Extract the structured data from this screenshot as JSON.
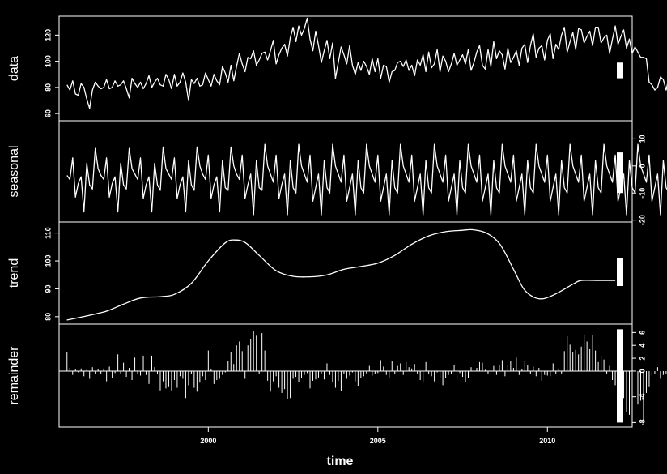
{
  "colors": {
    "background": "#000000",
    "foreground": "#ffffff"
  },
  "chart_data": {
    "type": "line",
    "title": "",
    "xlabel": "time",
    "xlim": [
      1995.6,
      2012.5
    ],
    "xticks": [
      2000,
      2005,
      2010
    ],
    "xtick_labels": [
      "2000",
      "2005",
      "2010"
    ],
    "panels": [
      {
        "name": "data",
        "label": "data",
        "kind": "line",
        "ylim": [
          57,
          132
        ],
        "yticks": [
          60,
          80,
          100,
          120
        ],
        "ytick_labels": [
          "60",
          "80",
          "100",
          "120"
        ],
        "tick_side": "left",
        "scale_bar": [
          87,
          99
        ],
        "x_start": 1995.8333,
        "x_step": 0.0833333,
        "values": [
          82,
          78,
          85,
          75,
          74,
          83,
          80,
          71,
          64,
          78,
          84,
          81,
          79,
          80,
          86,
          79,
          80,
          85,
          81,
          82,
          85,
          79,
          72,
          87,
          83,
          80,
          84,
          79,
          83,
          89,
          80,
          84,
          87,
          82,
          81,
          90,
          86,
          79,
          90,
          81,
          84,
          91,
          84,
          70,
          86,
          83,
          87,
          81,
          82,
          91,
          86,
          81,
          90,
          85,
          82,
          96,
          91,
          84,
          97,
          85,
          96,
          106,
          98,
          92,
          103,
          102,
          108,
          97,
          101,
          106,
          107,
          101,
          108,
          116,
          98,
          105,
          110,
          113,
          104,
          118,
          126,
          115,
          127,
          120,
          125,
          133,
          117,
          108,
          123,
          112,
          99,
          108,
          116,
          102,
          114,
          87,
          99,
          111,
          105,
          98,
          112,
          97,
          90,
          99,
          93,
          100,
          96,
          90,
          102,
          92,
          102,
          87,
          97,
          96,
          84,
          92,
          93,
          99,
          100,
          96,
          101,
          93,
          97,
          89,
          101,
          97,
          105,
          92,
          107,
          95,
          98,
          109,
          92,
          104,
          100,
          92,
          98,
          106,
          97,
          101,
          105,
          98,
          109,
          93,
          99,
          107,
          112,
          97,
          94,
          109,
          96,
          115,
          102,
          108,
          105,
          94,
          110,
          99,
          103,
          108,
          97,
          110,
          113,
          99,
          112,
          121,
          103,
          110,
          112,
          101,
          116,
          121,
          102,
          113,
          109,
          120,
          126,
          107,
          115,
          122,
          109,
          125,
          124,
          114,
          119,
          123,
          112,
          126,
          126,
          114,
          118,
          120,
          106,
          117,
          127,
          113,
          119,
          124,
          110,
          117,
          106,
          111,
          107,
          103,
          103,
          102,
          84,
          82,
          78,
          80,
          88,
          86,
          78,
          88,
          70,
          94,
          91,
          86,
          92,
          80,
          95,
          96,
          84,
          100,
          88,
          100,
          84,
          98,
          97,
          89,
          103,
          105,
          92,
          102,
          91,
          102,
          97,
          90,
          103,
          97,
          86,
          88,
          93,
          87,
          88
        ]
      },
      {
        "name": "seasonal",
        "label": "seasonal",
        "kind": "line",
        "ylim": [
          -19.5,
          15.5
        ],
        "yticks": [
          -20,
          -10,
          0,
          10
        ],
        "ytick_labels": [
          "-20",
          "-10",
          "0",
          "10"
        ],
        "tick_side": "right",
        "scale_bar": [
          -10,
          5
        ],
        "x_start": 1995.8333,
        "x_step": 0.0833333,
        "values": [
          -3.5,
          -5,
          3,
          -11.5,
          -6.5,
          -4,
          -17,
          1,
          -7,
          -8.5,
          6.5,
          -1,
          -3.5,
          -5,
          3,
          -11.5,
          -6.5,
          -4,
          -17,
          1,
          -7,
          -8.5,
          6.5,
          -1,
          -3,
          -5,
          3,
          -12,
          -7,
          -4,
          -17,
          1,
          -7,
          -9,
          7,
          -1,
          -3,
          -5,
          3,
          -12,
          -7,
          -4,
          -17,
          2,
          -7,
          -9,
          7,
          0,
          -3,
          -5,
          4,
          -12,
          -7,
          -4,
          -17,
          2,
          -8,
          -9,
          7,
          0,
          -3,
          -5,
          4,
          -12,
          -7,
          -3,
          -18,
          2,
          -8,
          -9,
          8,
          0,
          -3,
          -6,
          4,
          -12,
          -7,
          -3,
          -18,
          2,
          -8,
          -10,
          8,
          0,
          -3,
          -6,
          4,
          -13,
          -8,
          -3,
          -18,
          2,
          -8,
          -10,
          8,
          0,
          -3,
          -6,
          4,
          -13,
          -8,
          -3,
          -18,
          2,
          -8,
          -10,
          8,
          0,
          -3,
          -6,
          4,
          -13,
          -8,
          -3,
          -18,
          2,
          -8,
          -10,
          8,
          0,
          -3,
          -6,
          4,
          -13,
          -8,
          -3,
          -18,
          2,
          -8,
          -10,
          8,
          0,
          -3,
          -6,
          4,
          -13,
          -8,
          -3,
          -18,
          2,
          -8,
          -10,
          8,
          0,
          -3,
          -6,
          4,
          -13,
          -8,
          -3,
          -18,
          2,
          -8,
          -10,
          8,
          0,
          -3,
          -6,
          4,
          -13,
          -8,
          -3,
          -18,
          2,
          -8,
          -10,
          8,
          0,
          -3,
          -6,
          4,
          -13,
          -8,
          -3,
          -18,
          2,
          -8,
          -10,
          8,
          0,
          -3,
          -6,
          4,
          -13,
          -8,
          -3,
          -18,
          2,
          -8,
          -10,
          8,
          0,
          -3,
          -6,
          4,
          -13,
          -8,
          -3,
          -18,
          2,
          -8,
          -10,
          8,
          0,
          -3,
          -6,
          4,
          -13,
          -8,
          -3,
          -18,
          2,
          -8,
          -10,
          8,
          0,
          -3,
          -6,
          4,
          -13,
          -8,
          -3,
          -18,
          2,
          -8,
          -10,
          8,
          0,
          -3,
          -6,
          4,
          -13,
          -8,
          -3,
          -18,
          2,
          -8,
          -10,
          8,
          0,
          -3,
          -6,
          4,
          -13,
          -8,
          -3,
          -18,
          2,
          -8,
          -10,
          8,
          0,
          -3,
          -6,
          4,
          -13,
          -8,
          -3,
          -18,
          2,
          -8,
          -10,
          8,
          0,
          -3,
          -6,
          4,
          -13,
          -8,
          -3,
          -18,
          2,
          -8,
          -10,
          8,
          0,
          -3,
          -6,
          4,
          -13,
          -8,
          -3,
          -18,
          2,
          -8,
          -10,
          8,
          0,
          -2,
          -4,
          -3.5,
          1
        ]
      },
      {
        "name": "trend",
        "label": "trend",
        "kind": "line",
        "ylim": [
          78.5,
          112.8
        ],
        "yticks": [
          80,
          90,
          100,
          110
        ],
        "ytick_labels": [
          "80",
          "90",
          "100",
          "110"
        ],
        "tick_side": "left",
        "scale_bar": [
          91,
          101
        ],
        "points": [
          [
            1995.83,
            78.8
          ],
          [
            1996.5,
            80.5
          ],
          [
            1997.0,
            82
          ],
          [
            1997.5,
            84.5
          ],
          [
            1998.0,
            86.7
          ],
          [
            1998.6,
            87.2
          ],
          [
            1999.0,
            88
          ],
          [
            1999.5,
            92
          ],
          [
            2000.0,
            100
          ],
          [
            2000.5,
            106.5
          ],
          [
            2000.8,
            107.5
          ],
          [
            2001.1,
            106.5
          ],
          [
            2001.5,
            102
          ],
          [
            2002.0,
            96.5
          ],
          [
            2002.5,
            94.5
          ],
          [
            2003.0,
            94.3
          ],
          [
            2003.5,
            95
          ],
          [
            2004.0,
            97
          ],
          [
            2004.5,
            98
          ],
          [
            2005.0,
            99.2
          ],
          [
            2005.5,
            102
          ],
          [
            2006.0,
            106
          ],
          [
            2006.5,
            109
          ],
          [
            2007.0,
            110.5
          ],
          [
            2007.5,
            111
          ],
          [
            2007.8,
            111.2
          ],
          [
            2008.2,
            110
          ],
          [
            2008.6,
            106
          ],
          [
            2009.0,
            97
          ],
          [
            2009.3,
            90
          ],
          [
            2009.6,
            87
          ],
          [
            2009.9,
            86.5
          ],
          [
            2010.3,
            88.5
          ],
          [
            2010.8,
            92
          ],
          [
            2011.0,
            93
          ],
          [
            2011.5,
            93
          ],
          [
            2012.0,
            93
          ]
        ]
      },
      {
        "name": "remainder",
        "label": "remainder",
        "kind": "bar",
        "ylim": [
          -8.2,
          6.8
        ],
        "yticks": [
          -8,
          -4,
          0,
          2,
          4,
          6
        ],
        "ytick_labels": [
          "-8",
          "-4",
          "0",
          "2",
          "4",
          "6"
        ],
        "tick_side": "right",
        "scale_bar": [
          -8,
          6.5
        ],
        "x_start": 1995.8333,
        "x_step": 0.0833333,
        "values": [
          3,
          0.5,
          -0.6,
          0.3,
          -0.2,
          0.4,
          -0.8,
          0.2,
          -1.2,
          0.6,
          -0.4,
          0.3,
          -0.5,
          0.4,
          -1.6,
          0.7,
          -1.1,
          -0.3,
          2.6,
          -0.5,
          1.3,
          -0.9,
          0.5,
          -1.4,
          2.1,
          -0.4,
          -0.7,
          2.4,
          -0.6,
          -2,
          2.4,
          0.6,
          -0.5,
          -3,
          -1.6,
          -2.7,
          -2.5,
          -3,
          -1.4,
          -2.6,
          -0.8,
          -1.2,
          -4.2,
          -2.2,
          -0.4,
          -2.6,
          -3.2,
          -1.8,
          -0.8,
          -1.4,
          3.2,
          0.3,
          -2,
          -1.4,
          -1.2,
          -0.6,
          -0.2,
          1.6,
          2.9,
          1.1,
          4,
          4.6,
          3.1,
          -1.2,
          4,
          5,
          6.2,
          5.5,
          -0.4,
          5.9,
          3.2,
          -1.5,
          -3.2,
          -1.6,
          -0.8,
          -2.6,
          -3.4,
          -2.8,
          -4.3,
          -4.2,
          -1.2,
          -0.9,
          -1.7,
          -1.1,
          -0.6,
          -0.3,
          -2.7,
          -1.5,
          -1.3,
          -1,
          -0.5,
          -1.3,
          1.2,
          -0.6,
          -1.7,
          -2.6,
          -1.5,
          -3.1,
          -0.4,
          -1.2,
          -0.7,
          -0.2,
          -1.6,
          -2.3,
          -1.1,
          -0.8,
          -0.4,
          0.8,
          -0.7,
          -0.5,
          -0.3,
          1.7,
          0.7,
          -0.6,
          -1,
          1.5,
          -0.4,
          0.8,
          1.2,
          -0.6,
          1.4,
          0.6,
          0.4,
          1.1,
          -0.5,
          -1.4,
          -1.8,
          1.4,
          -0.4,
          -0.8,
          -1.6,
          -0.2,
          -1.2,
          -2.2,
          -1.1,
          -0.6,
          -0.4,
          0.9,
          -1.4,
          -0.3,
          -0.9,
          -1.7,
          -1.1,
          0.6,
          -1.2,
          0.5,
          1.4,
          1.3,
          0.2,
          -0.5,
          -0.2,
          0.8,
          -0.6,
          0.9,
          1.7,
          -0.8,
          1,
          1.6,
          0.5,
          2.1,
          -0.6,
          0.3,
          1.6,
          1,
          -0.4,
          0.7,
          -0.8,
          0.5,
          -1.5,
          -0.6,
          -0.7,
          -0.8,
          1.2,
          -0.5,
          0.4,
          -0.4,
          3.1,
          5.4,
          4.1,
          2.9,
          3.3,
          2.6,
          3.8,
          5.7,
          4.6,
          3.4,
          5.6,
          3.2,
          1.4,
          2.4,
          1.8,
          -0.5,
          0.8,
          -1.4,
          -2.2,
          -3.5,
          -5.6,
          -4.2,
          -6.3,
          -6.8,
          -5.8,
          -7.5,
          -5.2,
          -4.6,
          -8.1,
          -3.4,
          -2.5,
          -0.8,
          -0.4,
          0.6,
          -1.2,
          -0.6,
          -0.5,
          0.2,
          0.7,
          -1.3,
          1.2,
          -0.2,
          2.7,
          0.6,
          -0.4,
          1.2,
          0.3,
          -1.1,
          0.8,
          2.2,
          -0.6,
          2.7,
          2.4,
          1.8,
          -2.3,
          0.6,
          2.8,
          -0.8,
          2.5,
          1.4,
          1.7,
          0.4,
          -0.3,
          1.2,
          2.8,
          -0.6,
          -0.4,
          0.3,
          -1.5,
          -3.2,
          -1.1,
          -2,
          -3
        ]
      }
    ]
  }
}
